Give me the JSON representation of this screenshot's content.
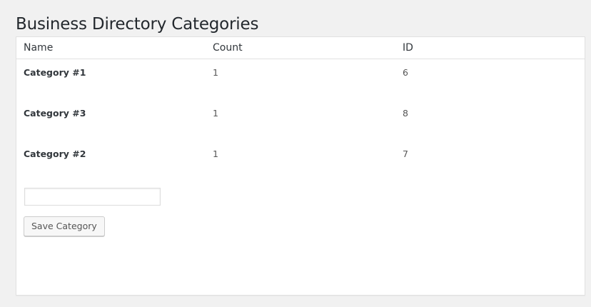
{
  "page": {
    "title": "Business Directory Categories"
  },
  "table": {
    "headers": {
      "name": "Name",
      "count": "Count",
      "id": "ID"
    },
    "rows": [
      {
        "name": "Category #1",
        "count": "1",
        "id": "6"
      },
      {
        "name": "Category #3",
        "count": "1",
        "id": "8"
      },
      {
        "name": "Category #2",
        "count": "1",
        "id": "7"
      }
    ]
  },
  "form": {
    "new_category_value": "",
    "save_label": "Save Category"
  }
}
